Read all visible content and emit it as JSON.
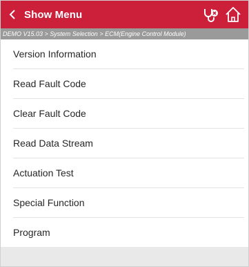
{
  "header": {
    "title": "Show Menu",
    "back_icon": "chevron-left-icon",
    "icons": [
      "stethoscope-icon",
      "home-icon"
    ],
    "background_color": "#cc1f3a"
  },
  "breadcrumb": {
    "text": "DEMO V15.03 > System Selection > ECM(Engine Control Module)"
  },
  "menu": {
    "items": [
      {
        "label": "Version Information"
      },
      {
        "label": "Read Fault Code"
      },
      {
        "label": "Clear Fault Code"
      },
      {
        "label": "Read Data Stream"
      },
      {
        "label": "Actuation Test"
      },
      {
        "label": "Special Function"
      },
      {
        "label": "Program"
      }
    ]
  }
}
